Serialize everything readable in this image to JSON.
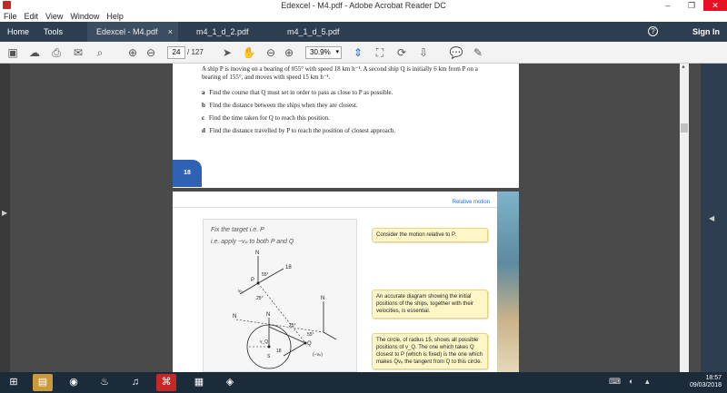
{
  "window": {
    "title": "Edexcel - M4.pdf - Adobe Acrobat Reader DC",
    "minimize": "–",
    "maximize": "❐",
    "close": "✕"
  },
  "menu": [
    "File",
    "Edit",
    "View",
    "Window",
    "Help"
  ],
  "nav": {
    "home": "Home",
    "tools": "Tools",
    "help": "?",
    "sign_in": "Sign In"
  },
  "tabs": [
    {
      "label": "Edexcel - M4.pdf",
      "close": "×"
    },
    {
      "label": "m4_1_d_2.pdf"
    },
    {
      "label": "m4_1_d_5.pdf"
    }
  ],
  "toolbar": {
    "current_page": "24",
    "page_total": "/ 127",
    "zoom": "30.9%"
  },
  "page1": {
    "intro": "A ship P is moving on a bearing of 055° with speed 18 km h⁻¹. A second ship Q is initially 6 km from P on a bearing of 155°, and moves with speed 15 km h⁻¹.",
    "questions": [
      {
        "letter": "a",
        "text": "Find the course that Q must set in order to pass as close to P as possible."
      },
      {
        "letter": "b",
        "text": "Find the distance between the ships when they are closest."
      },
      {
        "letter": "c",
        "text": "Find the time taken for Q to reach this position."
      },
      {
        "letter": "d",
        "text": "Find the distance travelled by P to reach the position of closest approach."
      }
    ],
    "page_number": "18"
  },
  "page2": {
    "header": "Relative motion",
    "handwritten_line1": "Fix the target i.e. P",
    "handwritten_line2": "i.e. apply −vₚ to both P and Q",
    "diagram_labels": {
      "n1": "N",
      "n2": "N",
      "n3": "N",
      "n_left": "N",
      "p": "P",
      "q": "Q",
      "speed18": "18",
      "speed18b": "18",
      "ang55": "55°",
      "ang25": "25°",
      "ang25b": "25°",
      "ang55b": "55°",
      "vp": "vₚ",
      "vq": "v_Q",
      "neg_vp": "(−vₚ)",
      "s": "S"
    },
    "notes": [
      "Consider the motion relative to P.",
      "An accurate diagram showing the initial positions of the ships, together with their velocities, is essential.",
      "The circle, of radius 15, shows all possible positions of v_Q. The one which takes Q closest to P (which is fixed) is the one which makes Qvₚ the tangent from Q to this circle."
    ]
  },
  "taskbar": {
    "time": "18:57",
    "date": "09/03/2018"
  },
  "colors": {
    "acrobat_nav": "#2d3e50",
    "page_badge": "#2f62b5",
    "note_bg": "#fff6c8",
    "taskbar": "#1c2b3a"
  }
}
